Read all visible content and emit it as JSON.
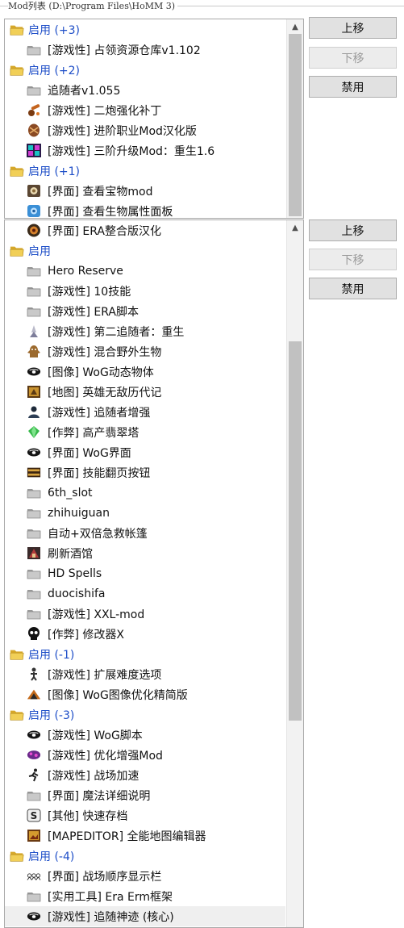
{
  "window": {
    "group_title": "Mod列表 (D:\\Program Files\\HoMM 3)"
  },
  "colors": {
    "group_text": "#1f4fc8",
    "folder": "#e8c14c",
    "disabled_text": "#9a9a9a"
  },
  "panel_top": {
    "buttons": {
      "up": "上移",
      "down": "下移",
      "disable": "禁用"
    },
    "rows": [
      {
        "kind": "group",
        "label": "启用 (+3)",
        "icon": "folder-icon"
      },
      {
        "kind": "item",
        "label": "[游戏性] 占领资源仓库v1.102",
        "icon": "folder-icon"
      },
      {
        "kind": "group",
        "label": "启用 (+2)",
        "icon": "folder-icon"
      },
      {
        "kind": "item",
        "label": "追随者v1.055",
        "icon": "folder-icon"
      },
      {
        "kind": "item",
        "label": "[游戏性] 二炮强化补丁",
        "icon": "cannon-icon"
      },
      {
        "kind": "item",
        "label": "[游戏性] 进阶职业Mod汉化版",
        "icon": "shield-icon"
      },
      {
        "kind": "item",
        "label": "[游戏性] 三阶升级Mod：重生1.6",
        "icon": "upgrade-icon"
      },
      {
        "kind": "group",
        "label": "启用 (+1)",
        "icon": "folder-icon"
      },
      {
        "kind": "item",
        "label": "[界面] 查看宝物mod",
        "icon": "artifact-icon"
      },
      {
        "kind": "item",
        "label": "[界面] 查看生物属性面板",
        "icon": "creature-panel-icon"
      }
    ]
  },
  "panel_bottom": {
    "buttons": {
      "up": "上移",
      "down": "下移",
      "disable": "禁用"
    },
    "rows": [
      {
        "kind": "item",
        "label": "[界面] ERA整合版汉化",
        "icon": "era-icon"
      },
      {
        "kind": "group",
        "label": "启用",
        "icon": "folder-icon"
      },
      {
        "kind": "item",
        "label": "Hero Reserve",
        "icon": "folder-icon"
      },
      {
        "kind": "item",
        "label": "[游戏性] 10技能",
        "icon": "folder-icon"
      },
      {
        "kind": "item",
        "label": "[游戏性] ERA脚本",
        "icon": "folder-icon"
      },
      {
        "kind": "item",
        "label": "[游戏性] 第二追随者：重生",
        "icon": "follower-icon"
      },
      {
        "kind": "item",
        "label": "[游戏性] 混合野外生物",
        "icon": "monster-icon"
      },
      {
        "kind": "item",
        "label": "[图像] WoG动态物体",
        "icon": "wog-icon"
      },
      {
        "kind": "item",
        "label": "[地图] 英雄无敌历代记",
        "icon": "chronicles-icon"
      },
      {
        "kind": "item",
        "label": "[游戏性] 追随者增强",
        "icon": "follower-boost-icon"
      },
      {
        "kind": "item",
        "label": "[作弊] 高产翡翠塔",
        "icon": "emerald-icon"
      },
      {
        "kind": "item",
        "label": "[界面] WoG界面",
        "icon": "wog-icon"
      },
      {
        "kind": "item",
        "label": "[界面] 技能翻页按钮",
        "icon": "skill-page-icon"
      },
      {
        "kind": "item",
        "label": "6th_slot",
        "icon": "folder-icon"
      },
      {
        "kind": "item",
        "label": "zhihuiguan",
        "icon": "folder-icon"
      },
      {
        "kind": "item",
        "label": "自动+双倍急救帐篷",
        "icon": "folder-icon"
      },
      {
        "kind": "item",
        "label": "刷新酒馆",
        "icon": "tavern-icon"
      },
      {
        "kind": "item",
        "label": "HD Spells",
        "icon": "folder-icon"
      },
      {
        "kind": "item",
        "label": "duocishifa",
        "icon": "folder-icon"
      },
      {
        "kind": "item",
        "label": "[游戏性] XXL-mod",
        "icon": "folder-icon"
      },
      {
        "kind": "item",
        "label": "[作弊] 修改器X",
        "icon": "skull-icon"
      },
      {
        "kind": "group",
        "label": "启用 (-1)",
        "icon": "folder-icon"
      },
      {
        "kind": "item",
        "label": "[游戏性] 扩展难度选项",
        "icon": "difficulty-icon"
      },
      {
        "kind": "item",
        "label": "[图像] WoG图像优化精简版",
        "icon": "wog-image-icon"
      },
      {
        "kind": "group",
        "label": "启用 (-3)",
        "icon": "folder-icon"
      },
      {
        "kind": "item",
        "label": "[游戏性] WoG脚本",
        "icon": "wog-icon"
      },
      {
        "kind": "item",
        "label": "[游戏性] 优化增强Mod",
        "icon": "enhance-icon"
      },
      {
        "kind": "item",
        "label": "[游戏性] 战场加速",
        "icon": "runner-icon"
      },
      {
        "kind": "item",
        "label": "[界面] 魔法详细说明",
        "icon": "folder-icon"
      },
      {
        "kind": "item",
        "label": "[其他] 快速存档",
        "icon": "save-icon"
      },
      {
        "kind": "item",
        "label": "[MAPEDITOR] 全能地图编辑器",
        "icon": "map-editor-icon"
      },
      {
        "kind": "group",
        "label": "启用 (-4)",
        "icon": "folder-icon"
      },
      {
        "kind": "item",
        "label": "[界面] 战场顺序显示栏",
        "icon": "order-bar-icon"
      },
      {
        "kind": "item",
        "label": "[实用工具] Era Erm框架",
        "icon": "folder-icon"
      },
      {
        "kind": "item",
        "label": "[游戏性] 追随神迹 (核心)",
        "icon": "wog-icon",
        "selected": true
      }
    ]
  }
}
